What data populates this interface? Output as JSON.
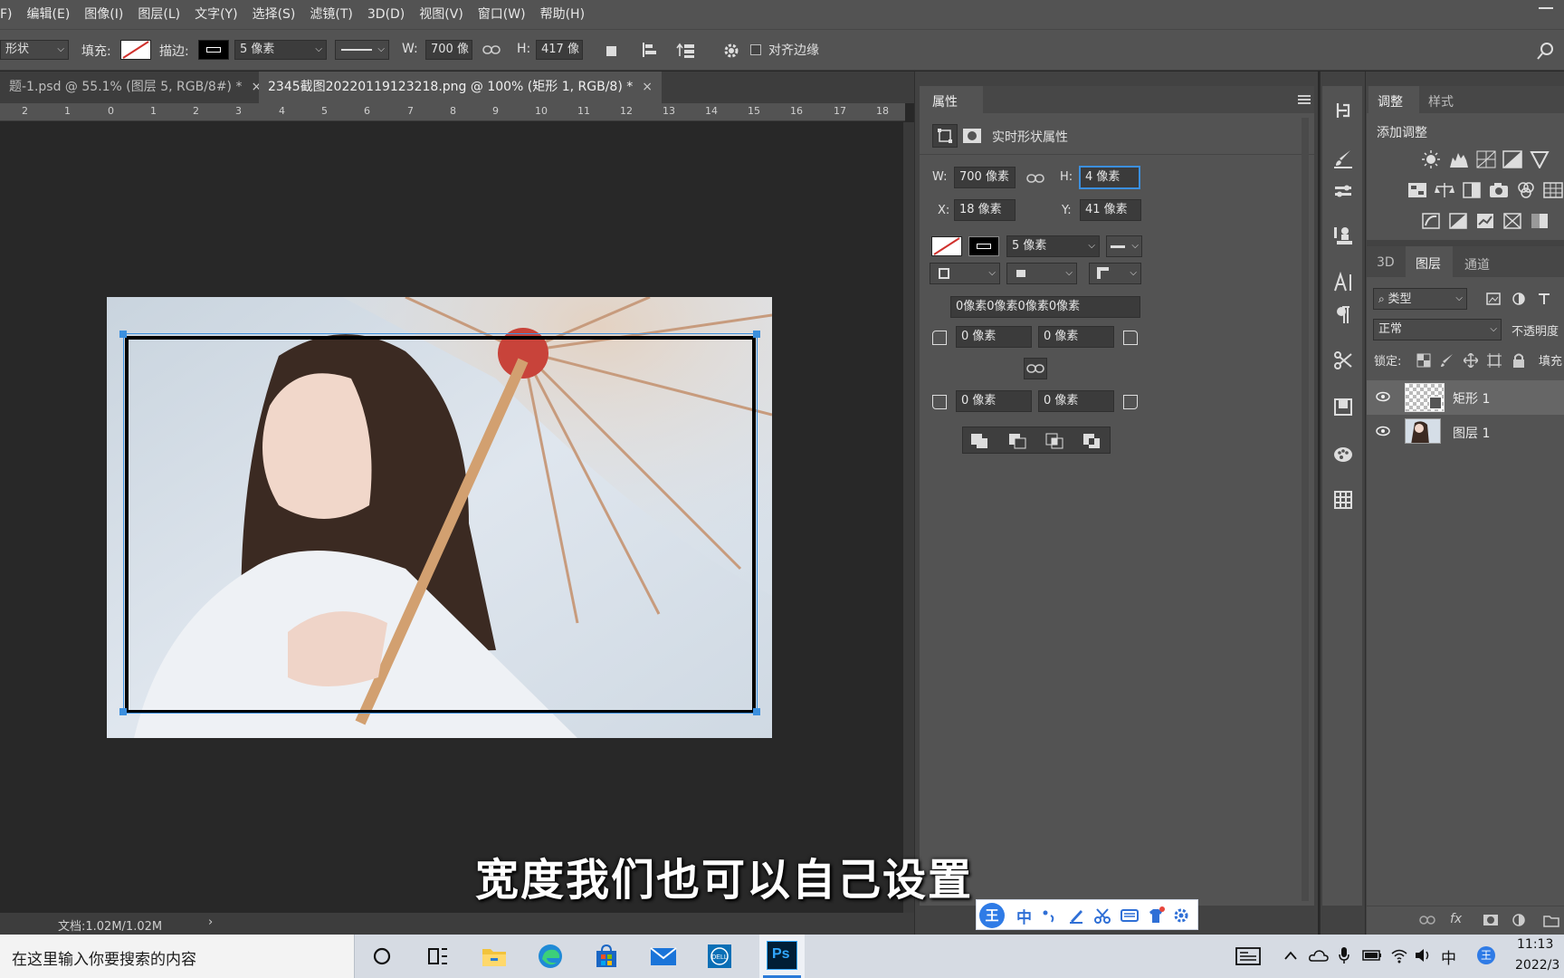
{
  "menu": {
    "items": [
      "F)",
      "编辑(E)",
      "图像(I)",
      "图层(L)",
      "文字(Y)",
      "选择(S)",
      "滤镜(T)",
      "3D(D)",
      "视图(V)",
      "窗口(W)",
      "帮助(H)"
    ]
  },
  "options": {
    "shape_mode": "形状",
    "fill_label": "填充:",
    "stroke_label": "描边:",
    "stroke_width": "5 像素",
    "w_label": "W:",
    "w_value": "700 像",
    "h_label": "H:",
    "h_value": "417 像",
    "align_edges": "对齐边缘"
  },
  "tabs": [
    {
      "label": "题-1.psd @ 55.1% (图层 5, RGB/8#) *",
      "close": "×"
    },
    {
      "label": "2345截图20220119123218.png @ 100% (矩形 1, RGB/8) *",
      "close": "×"
    }
  ],
  "ruler": [
    "2",
    "1",
    "0",
    "1",
    "2",
    "3",
    "4",
    "5",
    "6",
    "7",
    "8",
    "9",
    "10",
    "11",
    "12",
    "13",
    "14",
    "15",
    "16",
    "17",
    "18"
  ],
  "status": {
    "doc": "文档:1.02M/1.02M",
    "arrow": "›"
  },
  "subtitle": "宽度我们也可以自己设置",
  "properties": {
    "title": "属性",
    "header": "实时形状属性",
    "w_label": "W:",
    "w_value": "700 像素",
    "h_label": "H:",
    "h_value": "4 像素",
    "x_label": "X:",
    "x_value": "18 像素",
    "y_label": "Y:",
    "y_value": "41 像素",
    "stroke_width": "5 像素",
    "corners_all": "0像素0像素0像素0像素",
    "corner_tl": "0 像素",
    "corner_tr": "0 像素",
    "corner_bl": "0 像素",
    "corner_br": "0 像素"
  },
  "adjust": {
    "tab1": "调整",
    "tab2": "样式",
    "add": "添加调整"
  },
  "layers_panel": {
    "tab_3d": "3D",
    "tab_layers": "图层",
    "tab_channels": "通道",
    "filter": "类型",
    "blend": "正常",
    "opacity_label": "不透明度",
    "lock_label": "锁定:",
    "fill_label": "填充",
    "layers": [
      {
        "name": "矩形 1"
      },
      {
        "name": "图层 1"
      }
    ]
  },
  "taskbar": {
    "search_placeholder": "在这里输入你要搜索的内容",
    "time": "11:13",
    "date": "2022/3",
    "ime1": "中",
    "ime_logo": "王"
  },
  "colors": {
    "accent": "#3b8fde",
    "ps_blue": "#31a8ff",
    "panel": "#535353"
  }
}
